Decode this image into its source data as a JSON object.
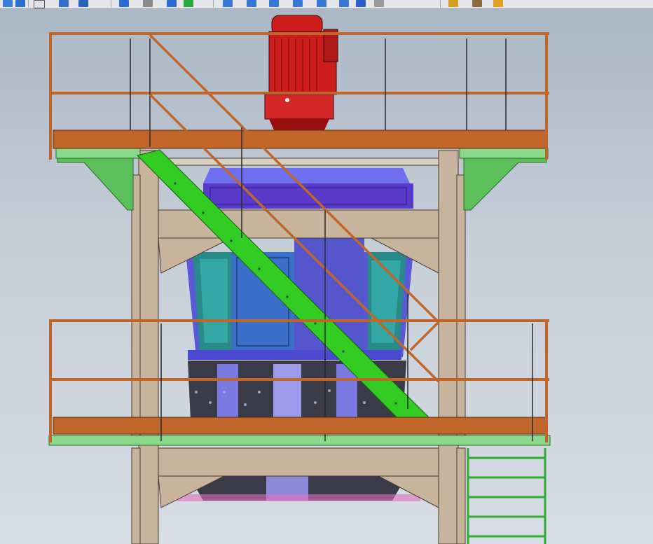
{
  "app": {
    "viewport_label": ""
  },
  "toolbar": {
    "buttons": [
      {
        "icon": "view-cube-icon"
      },
      {
        "icon": "select-arrow-icon"
      },
      {
        "icon": "zoom-fit-icon"
      },
      {
        "icon": "section-view-icon"
      },
      {
        "icon": "previous-view-icon"
      },
      {
        "icon": "rotate-icon"
      },
      {
        "icon": "pan-icon"
      },
      {
        "icon": "play-icon"
      },
      {
        "icon": "view-orientation-icon"
      },
      {
        "icon": "display-style-icon"
      },
      {
        "icon": "wireframe-icon"
      },
      {
        "icon": "hidden-lines-icon"
      },
      {
        "icon": "shaded-edges-icon"
      },
      {
        "icon": "shaded-icon"
      },
      {
        "icon": "perspective-icon"
      },
      {
        "icon": "lighting-icon"
      },
      {
        "icon": "appearance-icon"
      },
      {
        "icon": "scene-icon"
      }
    ]
  },
  "colors": {
    "railing": "#c0662a",
    "steel_frame": "#c8b49c",
    "ladder": "#33cc22",
    "motor": "#cc1c1c",
    "mill_body": "#5a5ad8",
    "mill_teal": "#2a9a9a",
    "support_green": "#5cbf5c",
    "grinding_ring": "#3a3a48"
  }
}
